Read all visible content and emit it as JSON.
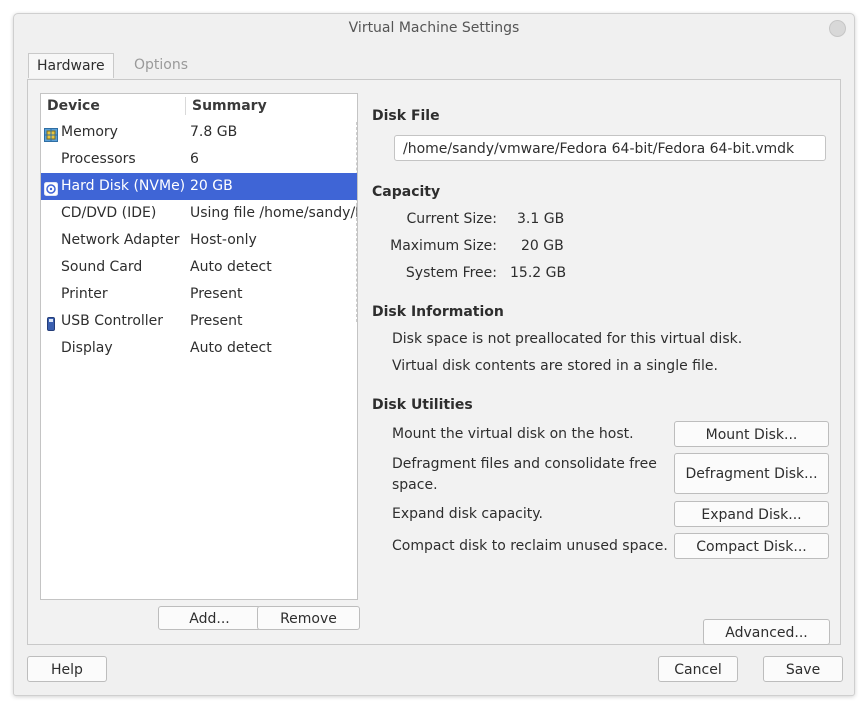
{
  "window": {
    "title": "Virtual Machine Settings"
  },
  "tabs": [
    {
      "label": "Hardware"
    },
    {
      "label": "Options"
    }
  ],
  "device_list": {
    "headers": {
      "device": "Device",
      "summary": "Summary"
    },
    "rows": [
      {
        "device": "Memory",
        "summary": "7.8 GB",
        "icon": "memory-icon"
      },
      {
        "device": "Processors",
        "summary": "6",
        "icon": ""
      },
      {
        "device": "Hard Disk (NVMe)",
        "summary": "20 GB",
        "icon": "hard-disk-icon"
      },
      {
        "device": "CD/DVD (IDE)",
        "summary": "Using file /home/sandy/D",
        "icon": ""
      },
      {
        "device": "Network Adapter",
        "summary": "Host-only",
        "icon": ""
      },
      {
        "device": "Sound Card",
        "summary": "Auto detect",
        "icon": ""
      },
      {
        "device": "Printer",
        "summary": "Present",
        "icon": ""
      },
      {
        "device": "USB Controller",
        "summary": "Present",
        "icon": "usb-icon"
      },
      {
        "device": "Display",
        "summary": "Auto detect",
        "icon": ""
      }
    ],
    "add_label": "Add...",
    "remove_label": "Remove"
  },
  "disk_file": {
    "title": "Disk File",
    "path": "/home/sandy/vmware/Fedora 64-bit/Fedora 64-bit.vmdk"
  },
  "capacity": {
    "title": "Capacity",
    "current_label": "Current Size:",
    "current_value": "3.1 GB",
    "maximum_label": "Maximum Size:",
    "maximum_value": "20 GB",
    "free_label": "System Free:",
    "free_value": "15.2 GB"
  },
  "disk_info": {
    "title": "Disk Information",
    "line1": "Disk space is not preallocated for this virtual disk.",
    "line2": "Virtual disk contents are stored in a single file."
  },
  "disk_utilities": {
    "title": "Disk Utilities",
    "mount_text": "Mount the virtual disk on the host.",
    "mount_btn": "Mount Disk...",
    "defrag_text_1": "Defragment files and consolidate free",
    "defrag_text_2": "space.",
    "defrag_btn": "Defragment Disk...",
    "expand_text": "Expand disk capacity.",
    "expand_btn": "Expand Disk...",
    "compact_text": "Compact disk to reclaim unused space.",
    "compact_btn": "Compact Disk..."
  },
  "advanced_label": "Advanced...",
  "footer": {
    "help_label": "Help",
    "cancel_label": "Cancel",
    "save_label": "Save"
  },
  "colors": {
    "selection": "#3f65d6",
    "window_bg": "#f0f0f0"
  }
}
